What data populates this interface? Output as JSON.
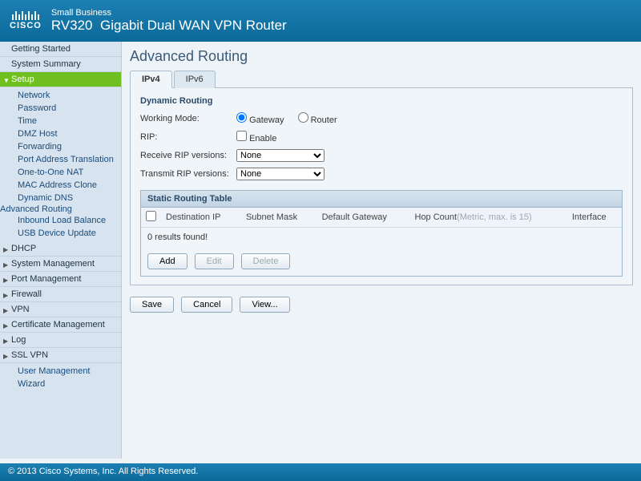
{
  "header": {
    "small": "Small Business",
    "brand": "CISCO",
    "model": "RV320",
    "desc": "Gigabit Dual WAN VPN Router"
  },
  "nav": {
    "getting_started": "Getting Started",
    "system_summary": "System Summary",
    "setup": "Setup",
    "setup_items": {
      "network": "Network",
      "password": "Password",
      "time": "Time",
      "dmz": "DMZ Host",
      "forwarding": "Forwarding",
      "pat": "Port Address Translation",
      "nat": "One-to-One NAT",
      "mac": "MAC Address Clone",
      "ddns": "Dynamic DNS",
      "advr": "Advanced Routing",
      "ilb": "Inbound Load Balance",
      "usb": "USB Device Update"
    },
    "dhcp": "DHCP",
    "sysman": "System Management",
    "portman": "Port Management",
    "firewall": "Firewall",
    "vpn": "VPN",
    "certman": "Certificate Management",
    "log": "Log",
    "sslvpn": "SSL VPN",
    "userman": "User Management",
    "wizard": "Wizard"
  },
  "page": {
    "title": "Advanced Routing",
    "tabs": {
      "ipv4": "IPv4",
      "ipv6": "IPv6"
    },
    "section": "Dynamic Routing",
    "working_mode_label": "Working Mode:",
    "gateway": "Gateway",
    "router": "Router",
    "rip_label": "RIP:",
    "enable": "Enable",
    "receive_label": "Receive RIP versions:",
    "transmit_label": "Transmit RIP versions:",
    "drop_none": "None",
    "table_title": "Static Routing Table",
    "cols": {
      "dest": "Destination IP",
      "mask": "Subnet Mask",
      "gw": "Default Gateway",
      "hop": "Hop Count",
      "hop_hint": "(Metric, max. is 15)",
      "iface": "Interface"
    },
    "empty": "0 results found!",
    "btn_add": "Add",
    "btn_edit": "Edit",
    "btn_delete": "Delete",
    "btn_save": "Save",
    "btn_cancel": "Cancel",
    "btn_view": "View..."
  },
  "footer": "© 2013 Cisco Systems, Inc. All Rights Reserved."
}
